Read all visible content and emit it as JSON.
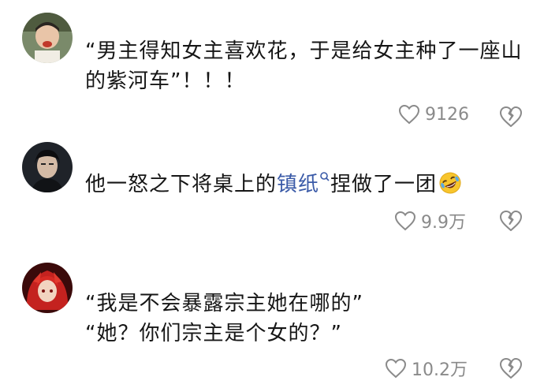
{
  "comments": [
    {
      "lines": [
        "“男主得知女主喜欢花，于是给女主种了一座山",
        "的紫河车”！！！"
      ],
      "likes": "9126",
      "avatar_icon": "child-photo-avatar"
    },
    {
      "before_link": "他一怒之下将桌上的",
      "link": "镇纸",
      "after_link": "捏做了一团",
      "emoji": "rolling-laugh-emoji",
      "likes": "9.9万",
      "avatar_icon": "dark-portrait-avatar"
    },
    {
      "lines": [
        "“我是不会暴露宗主她在哪的”",
        "“她？你们宗主是个女的？”"
      ],
      "likes": "10.2万",
      "avatar_icon": "red-hair-anime-avatar"
    }
  ],
  "colors": {
    "like_gray": "#8a8a8a",
    "link_blue": "#3b5ba8",
    "text": "#161616"
  }
}
